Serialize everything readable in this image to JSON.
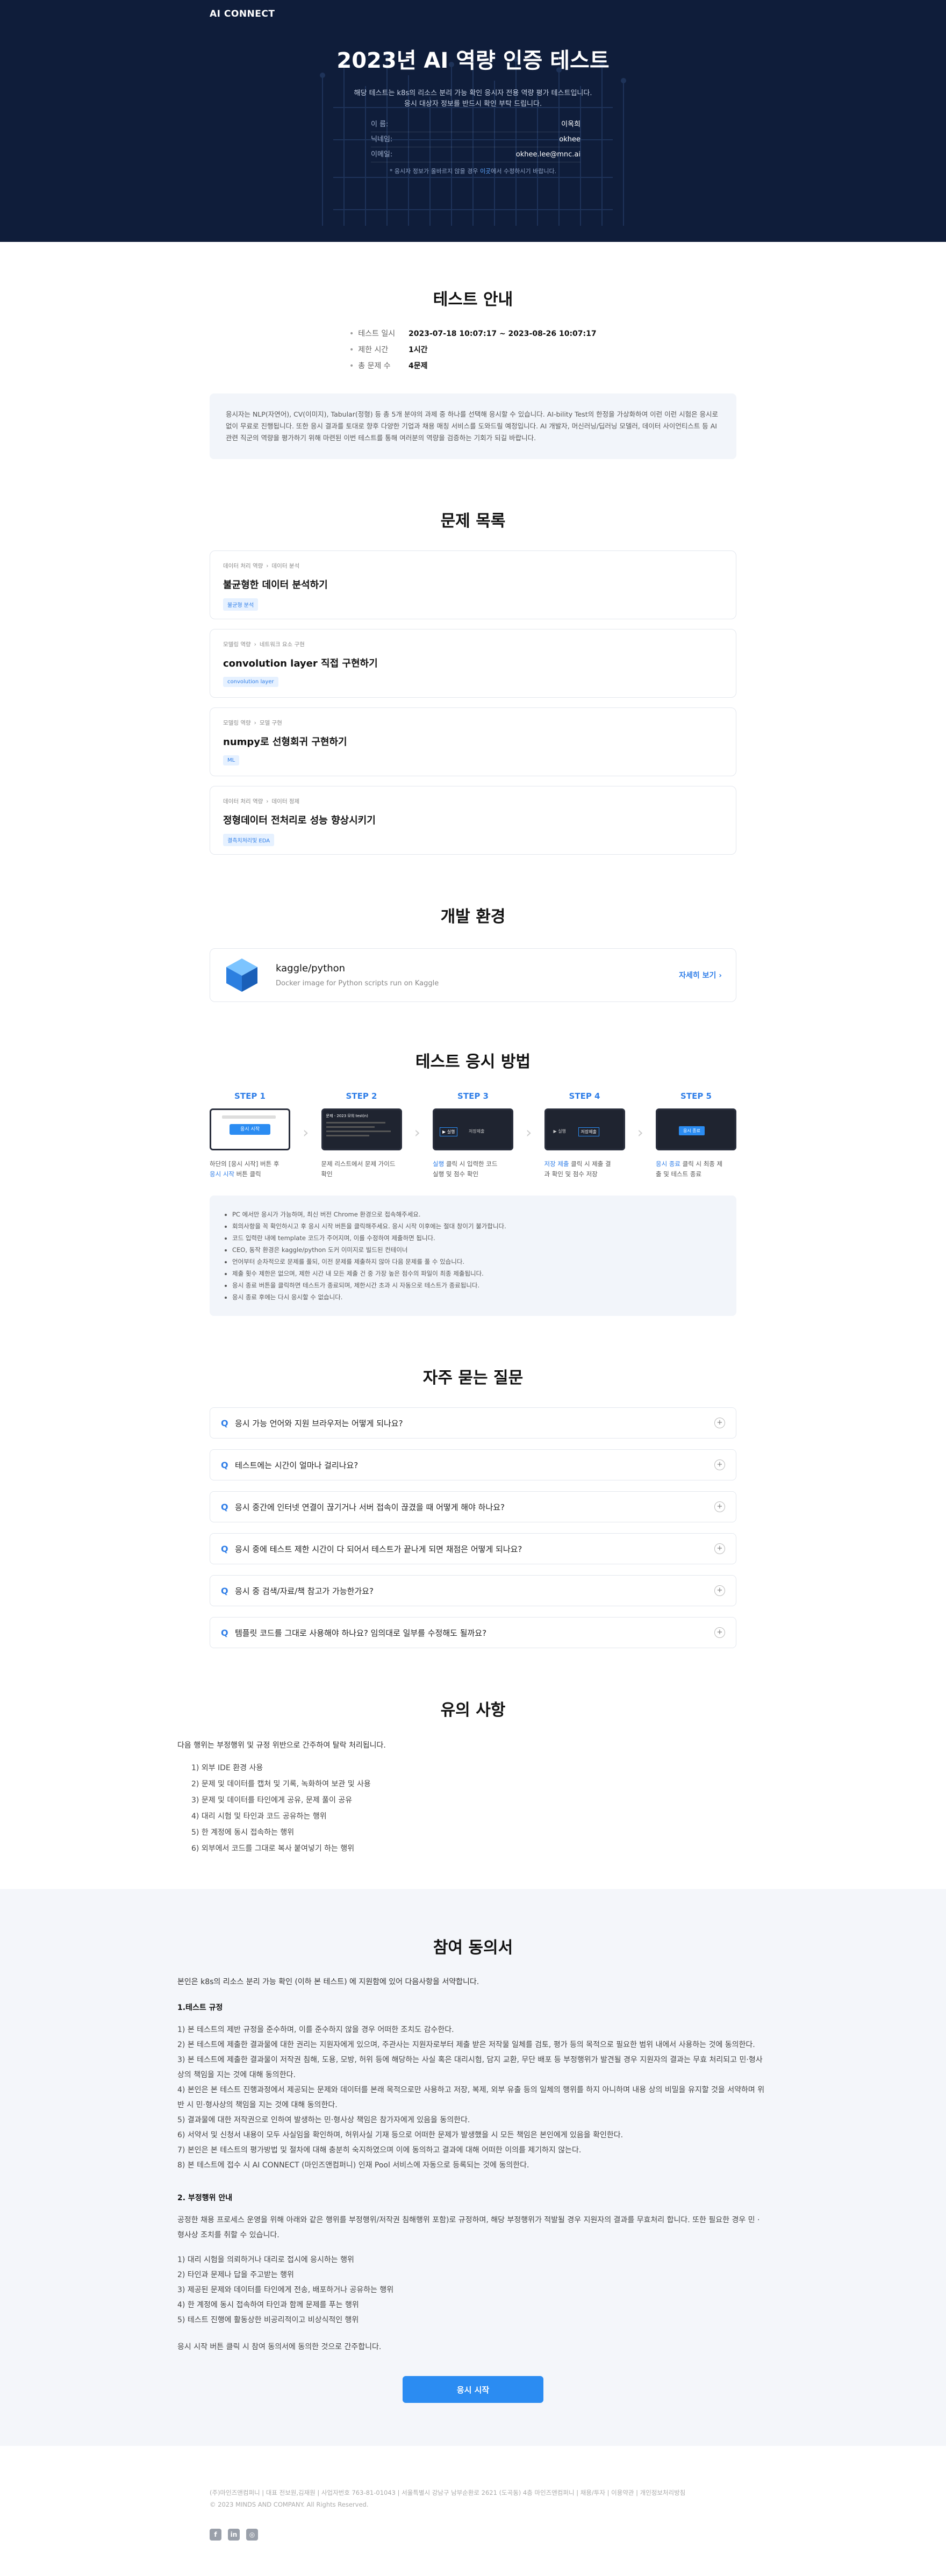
{
  "brand": "AI CONNECT",
  "hero": {
    "title": "2023년 AI 역량 인증 테스트",
    "desc1": "해당 테스트는 k8s의 리소스 분리 가능 확인 응시자 전용 역량 평가 테스트입니다.",
    "desc2": "응시 대상자 정보를 반드시 확인 부탁 드립니다.",
    "info": [
      {
        "label": "이 름:",
        "value": "이옥희"
      },
      {
        "label": "닉네임:",
        "value": "okhee"
      },
      {
        "label": "이메일:",
        "value": "okhee.lee@mnc.ai"
      }
    ],
    "note_prefix": "* 응시자 정보가 올바르지 않을 경우 ",
    "note_link": "이곳",
    "note_suffix": "에서 수정하시기 바랍니다."
  },
  "guide": {
    "title": "테스트 안내",
    "rows": [
      {
        "label": "테스트 일시",
        "value": "2023-07-18 10:07:17 ~ 2023-08-26 10:07:17"
      },
      {
        "label": "제한 시간",
        "value": "1시간"
      },
      {
        "label": "총 문제 수",
        "value": "4문제"
      }
    ],
    "notice": "응시자는 NLP(자연어), CV(이미지), Tabular(정형) 등 총 5개 분야의 과제 중 하나를 선택해 응시할 수 있습니다. AI-bility Test의 한정을 가상화하여 이런 이런 시험은 응시로 없이 무료로 진행됩니다. 또한 응시 결과를 토대로 향후 다양한 기업과 채용 매칭 서비스를 도와드릴 예정입니다. AI 개발자, 머신러닝/딥러닝 모델러, 데이터 사이언티스트 등 AI 관련 직군의 역량을 평가하기 위해 마련된 이번 테스트를 통해 여러분의 역량을 검증하는 기회가 되길 바랍니다."
  },
  "problems": {
    "title": "문제 목록",
    "items": [
      {
        "crumb1": "데이터 처리 역량",
        "crumb2": "데이터 분석",
        "title": "불균형한 데이터 분석하기",
        "tag": "불균형 분석"
      },
      {
        "crumb1": "모델링 역량",
        "crumb2": "네트워크 요소 구현",
        "title": "convolution layer 직접 구현하기",
        "tag": "convolution layer"
      },
      {
        "crumb1": "모델링 역량",
        "crumb2": "모델 구현",
        "title": "numpy로 선형회귀 구현하기",
        "tag": "ML"
      },
      {
        "crumb1": "데이터 처리 역량",
        "crumb2": "데이터 정제",
        "title": "정형데이터 전처리로 성능 향상시키기",
        "tag": "결측치처리및 EDA"
      }
    ]
  },
  "env": {
    "title": "개발 환경",
    "name": "kaggle/python",
    "desc": "Docker image for Python scripts run on Kaggle",
    "link": "자세히 보기 ›"
  },
  "howto": {
    "title": "테스트 응시 방법",
    "steps": [
      {
        "label": "STEP 1",
        "cap1": "하단의 [응시 시작] 버튼 후",
        "cap2_hl": "응시 시작",
        "cap2": " 버튼 클릭",
        "btn": "응시 시작"
      },
      {
        "label": "STEP 2",
        "cap1": "문제 리스트에서 문제 가이드",
        "cap2_hl": "",
        "cap2": "확인",
        "screen_title": "문제 - 2023 모의 test(n)"
      },
      {
        "label": "STEP 3",
        "cap1": "",
        "cap1_hl": "실행",
        "cap1_rest": " 클릭 시 입력한 코드",
        "cap2_hl": "",
        "cap2": "실행 및 점수 확인"
      },
      {
        "label": "STEP 4",
        "cap1_hl": "저장 제출",
        "cap1_rest": " 클릭 시 제출 결",
        "cap2_hl": "",
        "cap2": "과 확인 및 점수 저장"
      },
      {
        "label": "STEP 5",
        "cap1_hl": "응시 종료",
        "cap1_rest": " 클릭 시 최종 제",
        "cap2_hl": "",
        "cap2": "출 및 테스트 종료"
      }
    ],
    "run_btn": "▶ 실행",
    "save_btn": "저장제출",
    "end_btn": "응시 종료",
    "notes": [
      "PC 에서만 응시가 가능하며, 최신 버전 Chrome 환경으로 접속해주세요.",
      "회의사항을 꼭 확인하시고 후 응시 시작 버튼을 클릭해주세요. 응시 시작 이후에는 절대 창이기 불가합니다.",
      "코드 입력란 내에 template 코드가 주어지며, 이를 수정하여 제출하면 됩니다.",
      "CEO, 동작 환경은 kaggle/python 도커 이미지로 빌드된 컨테이너",
      "언어부터 순차적으로 문제를 풀되, 이전 문제를 제출하지 않아 다음 문제를 풀 수 있습니다.",
      "제출 횟수 제한은 없으며, 제한 시간 내 모든 제출 건 중 가장 높은 점수의 파일이 최종 제출됩니다.",
      "응시 종료 버튼을 클릭하면 테스트가 종료되며, 제한시간 초과 시 자동으로 테스트가 종료됩니다.",
      "응시 종료 후에는 다시 응시할 수 없습니다."
    ]
  },
  "faq": {
    "title": "자주 묻는 질문",
    "q_mark": "Q",
    "items": [
      "응시 가능 언어와 지원 브라우저는 어떻게 되나요?",
      "테스트에는 시간이 얼마나 걸리나요?",
      "응시 중간에 인터넷 연결이 끊기거나 서버 접속이 끊겼을 때 어떻게 해야 하나요?",
      "응시 중에 테스트 제한 시간이 다 되어서 테스트가 끝나게 되면 채점은 어떻게 되나요?",
      "응시 중 검색/자료/책 참고가 가능한가요?",
      "템플릿 코드를 그대로 사용해야 하나요? 임의대로 일부를 수정해도 될까요?"
    ]
  },
  "caution": {
    "title": "유의 사항",
    "intro": "다음 행위는 부정행위 및 규정 위반으로 간주하여 탈락 처리됩니다.",
    "items": [
      "1) 외부 IDE 환경 사용",
      "2) 문제 및 데이터를 캡처 및 기록, 녹화하여 보관 및 사용",
      "3) 문제 및 데이터를 타인에게 공유, 문제 풀이 공유",
      "4) 대리 시험 및 타인과 코드 공유하는 행위",
      "5) 한 계정에 동시 접속하는 행위",
      "6) 외부에서 코드를 그대로 복사 붙여넣기 하는 행위"
    ]
  },
  "consent": {
    "title": "참여 동의서",
    "intro": "본인은 k8s의 리소스 분리 가능 확인 (이하 본 테스트) 에 지원함에 있어 다음사항을 서약합니다.",
    "h1": "1.테스트 규정",
    "p1": [
      "1) 본 테스트의 제반 규정을 준수하며, 이를 준수하지 않을 경우 어떠한 조치도 감수한다.",
      "2) 본 테스트에 제출한 결과물에 대한 권리는 지원자에게 있으며, 주관사는 지원자로부터 제출 받은 저작물 일체를 검토, 평가 등의 목적으로 필요한 범위 내에서 사용하는 것에 동의한다.",
      "3) 본 테스트에 제출한 결과물이 저작권 침해, 도용, 모방, 허위 등에 해당하는 사실 혹은 대리시험, 담지 교환, 무단 배포 등 부정행위가 발견될 경우 지원자의 결과는 무효 처리되고 민·형사상의 책임을 지는 것에 대해 동의한다.",
      "4) 본인은 본 테스트 진행과정에서 제공되는 문제와 데이터를 본래 목적으로만 사용하고 저장, 복제, 외부 유출 등의 일체의 행위를 하지 아니하며 내용 상의 비밀을 유지할 것을 서약하며 위반 시 민·형사상의 책임을 지는 것에 대해 동의한다.",
      "5) 결과물에 대한 저작권으로 인하여 발생하는 민·형사상 책임은 참가자에게 있음을 동의한다.",
      "6) 서약서 및 신청서 내용이 모두 사실임을 확인하며, 허위사실 기재 등으로 어떠한 문제가 발생했을 시 모든 책임은 본인에게 있음을 확인한다.",
      "7) 본인은 본 테스트의 평가방법 및 절차에 대해 충분히 숙지하였으며 이에 동의하고 결과에 대해 어떠한 이의를 제기하지 않는다.",
      "8) 본 테스트에 접수 시 AI CONNECT (마인즈앤컴퍼니) 인재 Pool 서비스에 자동으로 등록되는 것에 동의한다."
    ],
    "h2": "2. 부정행위 안내",
    "p2_intro": "공정한 채용 프로세스 운영을 위해 아래와 같은 행위를 부정행위/저작권 침해행위 포함)로 규정하며, 해당 부정행위가 적발될 경우 지원자의 결과를 무효처리 합니다. 또한 필요한 경우 민 · 형사상 조치를 취할 수 있습니다.",
    "p2": [
      "1) 대리 시험을 의뢰하거나 대리로 접시에 응시하는 행위",
      "2) 타인과 문제나 답을 주고받는 행위",
      "3) 제공된 문제와 데이터를 타인에게 전송, 배포하거나 공유하는 행위",
      "4) 한 계정에 동시 접속하여 타인과 함께 문제를 푸는 행위",
      "5) 테스트 진행에 활동상한 비공리적이고 비상식적인 행위"
    ],
    "closing": "응시 시작 버튼 클릭 시 참여 동의서에 동의한 것으로 간주합니다.",
    "start_button": "응시 시작"
  },
  "footer": {
    "line1": "(주)마인즈앤컴퍼니 | 대표 전보원,김재원 | 사업자번호 763-81-01043 | 서울특별시 강남구 남부순환로 2621 (도곡동) 4층 마인즈앤컴퍼니 | 채용/투자 | 이용약관 | 개인정보처리방침",
    "line2": "© 2023 MINDS AND COMPANY. All Rights Reserved.",
    "social": [
      "f",
      "in",
      "◎"
    ]
  }
}
